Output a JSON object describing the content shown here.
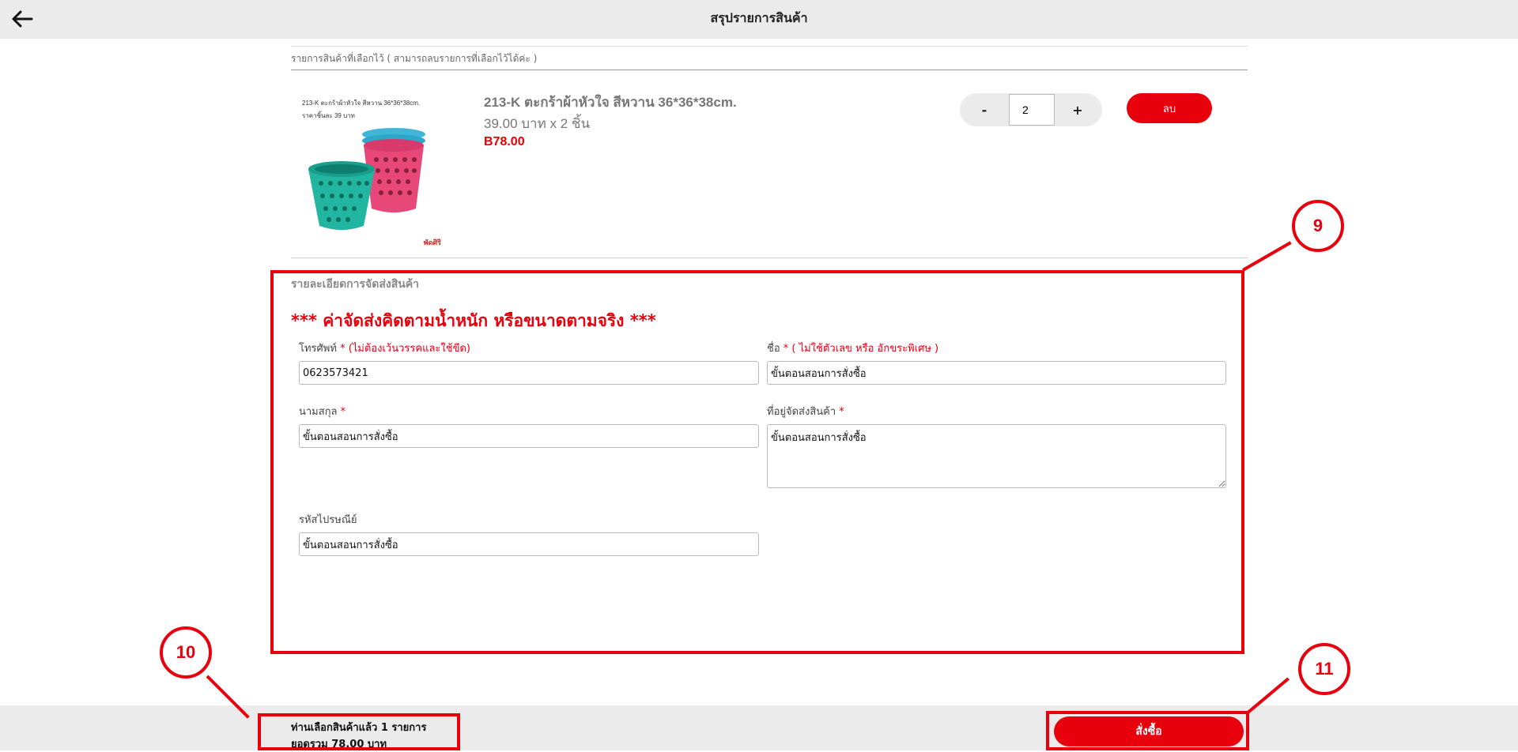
{
  "header": {
    "title": "สรุปรายการสินค้า",
    "back_icon": "arrow-left-icon"
  },
  "cart": {
    "caption": "รายการสินค้าที่เลือกไว้ ( สามารถลบรายการที่เลือกไว้ได้ค่ะ )",
    "item": {
      "image_text_line1": "213-K ตะกร้าผ้าหัวใจ สีหวาน 36*36*38cm.",
      "image_text_line2": "ราคาชิ้นละ 39 บาท",
      "image_brand": "พัดศิริ",
      "name": "213-K ตะกร้าผ้าหัวใจ สีหวาน 36*36*38cm.",
      "unit_price_line": "39.00 บาท x 2 ชิ้น",
      "total": "B78.00",
      "quantity": "2",
      "minus_label": "-",
      "plus_label": "+",
      "delete_label": "ลบ"
    }
  },
  "shipping": {
    "section_title": "รายละเอียดการจัดส่งสินค้า",
    "note": "*** ค่าจัดส่งคิดตามน้ำหนัก หรือขนาดตามจริง ***",
    "phone": {
      "label": "โทรศัพท์",
      "hint": " * (ไม่ต้องเว้นวรรคและใช้ขีด)",
      "value": "0623573421"
    },
    "firstname": {
      "label": "ชื่อ",
      "hint": " * ( ไม่ใช้ตัวเลข หรือ อักขระพิเศษ )",
      "value": "ขั้นตอนสอนการสั่งซื้อ"
    },
    "lastname": {
      "label": "นามสกุล",
      "hint": " *",
      "value": "ขั้นตอนสอนการสั่งซื้อ"
    },
    "address": {
      "label": "ที่อยู่จัดส่งสินค้า",
      "hint": " *",
      "value": "ขั้นตอนสอนการสั่งซื้อ"
    },
    "postcode": {
      "label": "รหัสไปรษณีย์",
      "value": "ขั้นตอนสอนการสั่งซื้อ"
    }
  },
  "footer": {
    "summary_line1": "ท่านเลือกสินค้าแล้ว 1 รายการ",
    "summary_line2": "ยอดรวม 78.00 บาท",
    "order_label": "สั่งซื้อ"
  },
  "annotations": {
    "step9": "9",
    "step10": "10",
    "step11": "11"
  },
  "colors": {
    "accent": "#e8000d",
    "header_bg": "#ebebeb"
  }
}
